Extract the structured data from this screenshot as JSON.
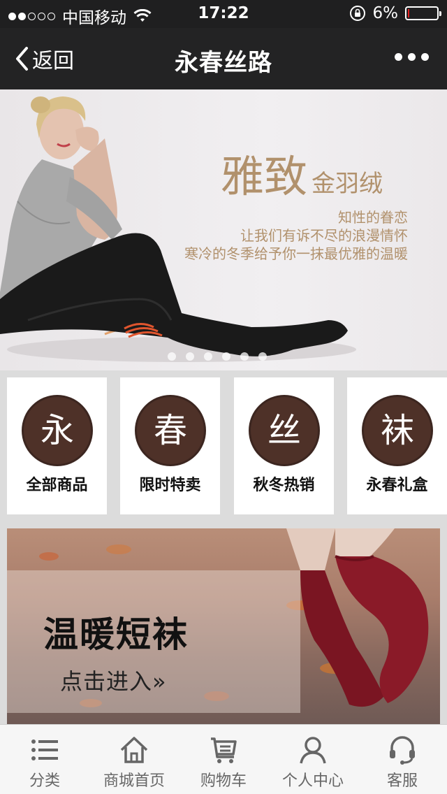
{
  "status_bar": {
    "carrier": "中国移动",
    "time": "17:22",
    "battery": "6%",
    "battery_level": 0.06,
    "signal_bars": 2
  },
  "nav": {
    "back_label": "返回",
    "title": "永春丝路"
  },
  "banner": {
    "headline_big": "雅致",
    "headline_small": "金羽绒",
    "copy_line1": "知性的眷恋",
    "copy_line2": "让我们有诉不尽的浪漫情怀",
    "copy_line3": "寒冷的冬季给予你一抹最优雅的温暖",
    "slide_count": 6
  },
  "categories": [
    {
      "char": "永",
      "label": "全部商品"
    },
    {
      "char": "春",
      "label": "限时特卖"
    },
    {
      "char": "丝",
      "label": "秋冬热销"
    },
    {
      "char": "袜",
      "label": "永春礼盒"
    }
  ],
  "promo": {
    "title": "温暖短袜",
    "cta": "点击进入»"
  },
  "tabs": [
    {
      "icon": "list-icon",
      "label": "分类"
    },
    {
      "icon": "home-icon",
      "label": "商城首页"
    },
    {
      "icon": "cart-icon",
      "label": "购物车"
    },
    {
      "icon": "person-icon",
      "label": "个人中心"
    },
    {
      "icon": "headset-icon",
      "label": "客服"
    }
  ],
  "colors": {
    "status_bg": "#1f1f20",
    "nav_bg": "#232324",
    "accent_gold": "#b1916c",
    "badge_brown": "#4e3128",
    "battery_low": "#e02020"
  }
}
